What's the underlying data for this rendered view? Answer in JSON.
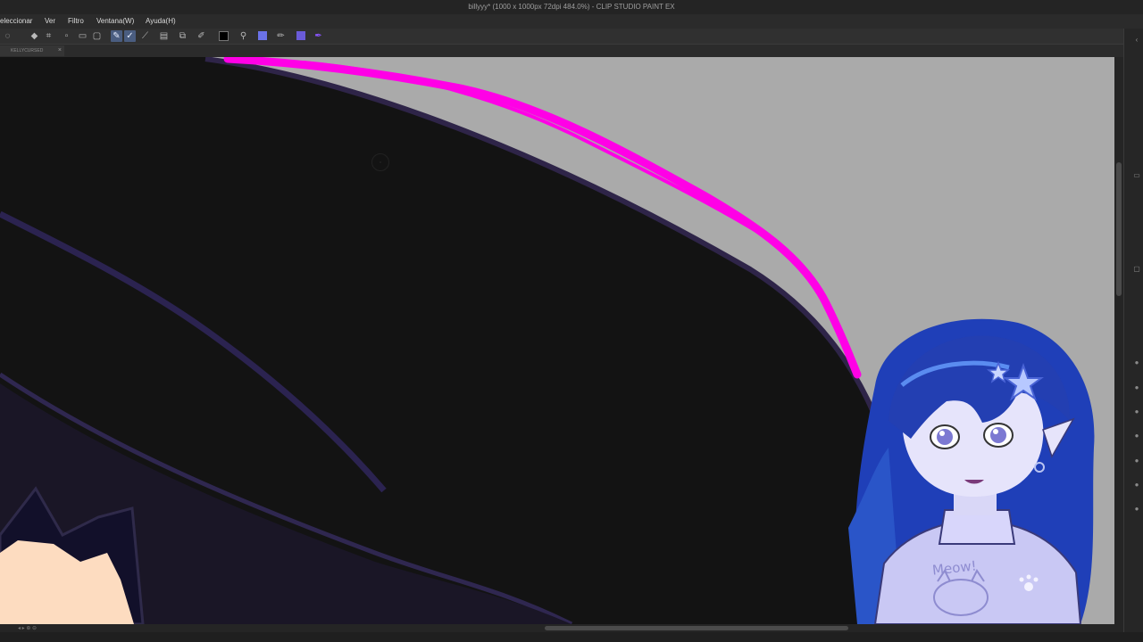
{
  "window": {
    "title": "billyyy* (1000 x 1000px 72dpi 484.0%) - CLIP STUDIO PAINT EX"
  },
  "menu": {
    "items": [
      "eleccionar",
      "Ver",
      "Filtro",
      "Ventana(W)",
      "Ayuda(H)"
    ]
  },
  "toolbar": {
    "icons": [
      "lasso-icon",
      "fill-icon",
      "transform-icon",
      "clear-icon",
      "crop-icon",
      "line-icon",
      "pen-icon",
      "pencil-icon",
      "ruler-icon",
      "layer-icon",
      "vector-icon",
      "pen-settings-icon",
      "color-swatch-icon",
      "eyedropper-icon",
      "magic-wand-icon",
      "pen-tool-icon",
      "gradient-icon",
      "purple-pen-icon"
    ]
  },
  "document_tab": {
    "label": "KELLYCURSED"
  },
  "colors": {
    "canvas_bg": "#aaaaaa",
    "dark_fill": "#131313",
    "outline_purple": "#2e2448",
    "magenta": "#ff00e6",
    "skin": "#fddcc0",
    "hair_blue": "#1f3fb8",
    "sweater": "#c9c8f4"
  },
  "webcam": {
    "sweater_text": "Meow!"
  }
}
